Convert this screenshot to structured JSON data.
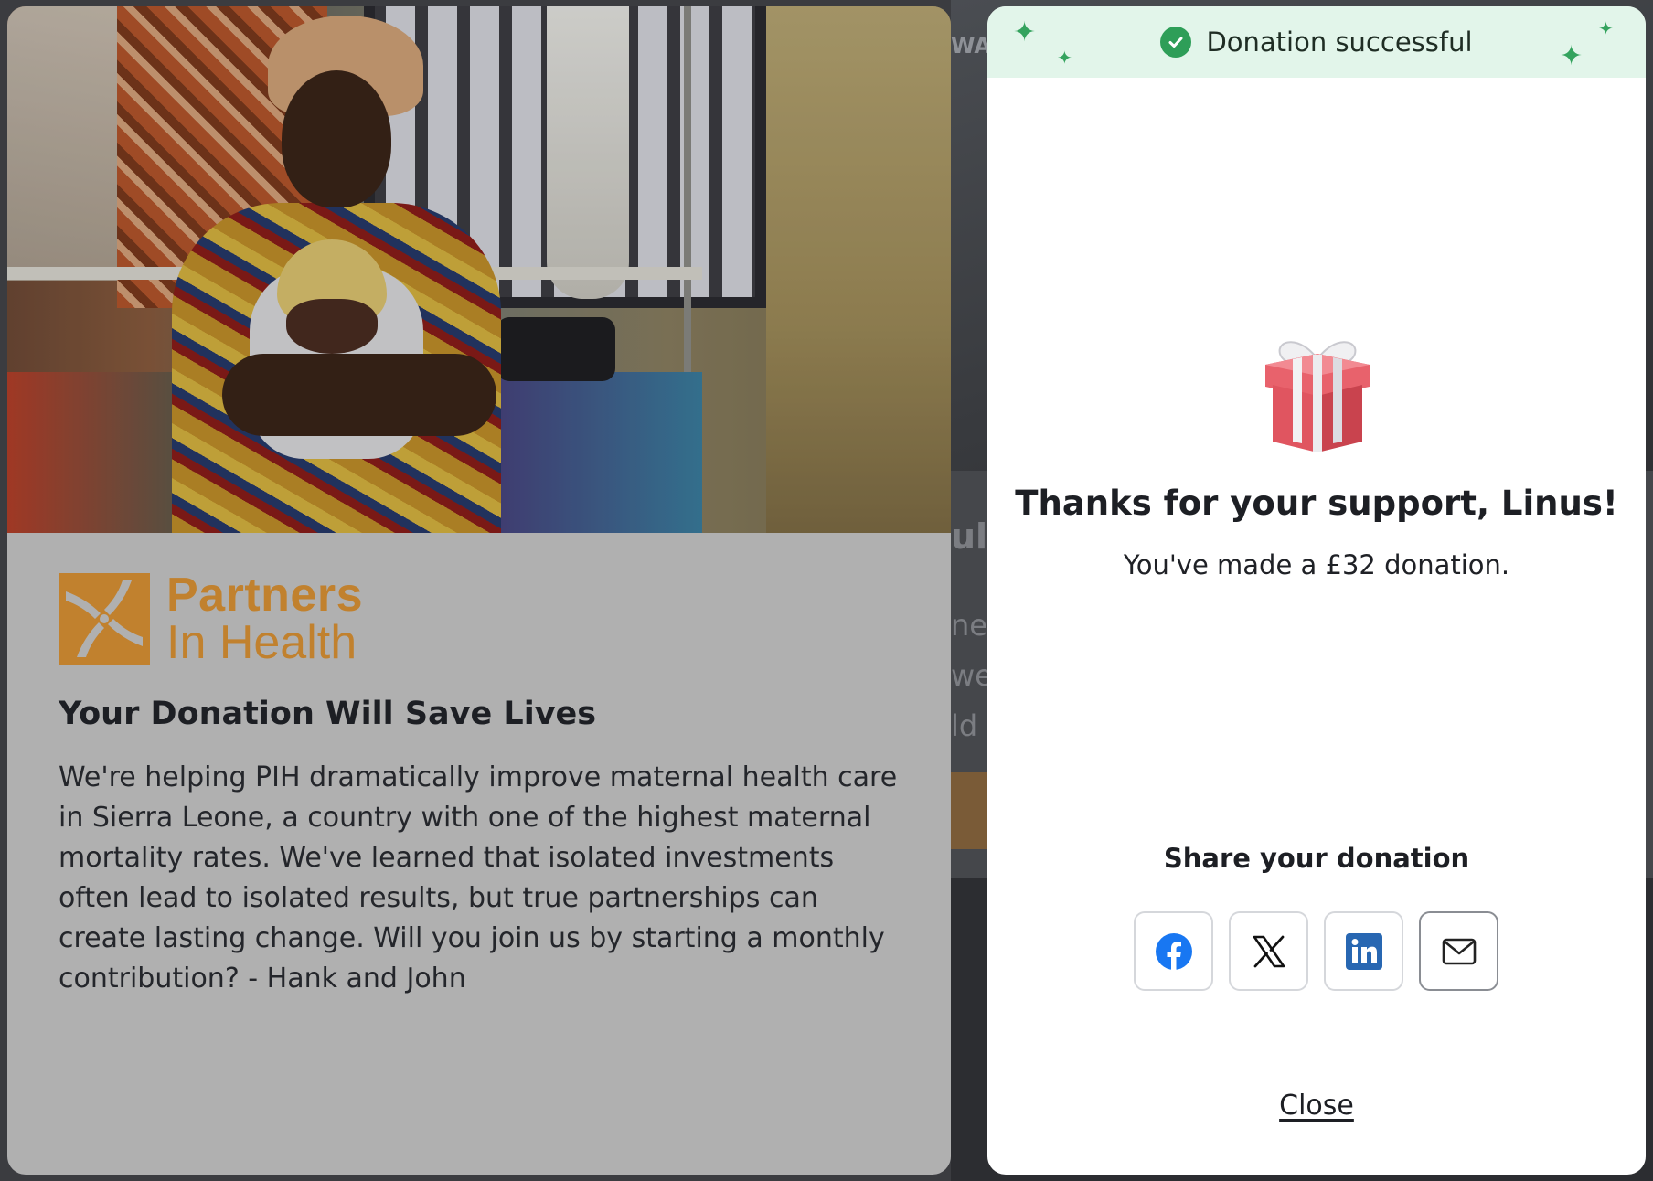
{
  "background": {
    "hero_fragment": "WA",
    "fragments": [
      "ul",
      "ne",
      "we",
      "ld"
    ]
  },
  "campaign": {
    "logo_line1": "Partners",
    "logo_line2": "In Health",
    "title": "Your Donation Will Save Lives",
    "description": "We're helping PIH dramatically improve maternal health care in Sierra Leone, a country with one of the highest maternal mortality rates. We've learned that isolated investments often lead to isolated results, but true partnerships can create lasting change. Will you join us by starting a monthly contribution? - Hank and John"
  },
  "modal": {
    "banner_text": "Donation successful",
    "thanks": "Thanks for your support, Linus!",
    "made": "You've made a £32 donation.",
    "share_title": "Share your donation",
    "share_buttons": [
      {
        "name": "facebook",
        "icon": "facebook-icon"
      },
      {
        "name": "x",
        "icon": "x-icon"
      },
      {
        "name": "linkedin",
        "icon": "linkedin-icon"
      },
      {
        "name": "email",
        "icon": "email-icon"
      }
    ],
    "close_label": "Close"
  },
  "colors": {
    "brand_orange": "#c1812e",
    "success_green": "#2e9e58",
    "banner_bg": "#e2f5ea",
    "facebook_blue": "#1877f2",
    "linkedin_blue": "#2867b2"
  }
}
